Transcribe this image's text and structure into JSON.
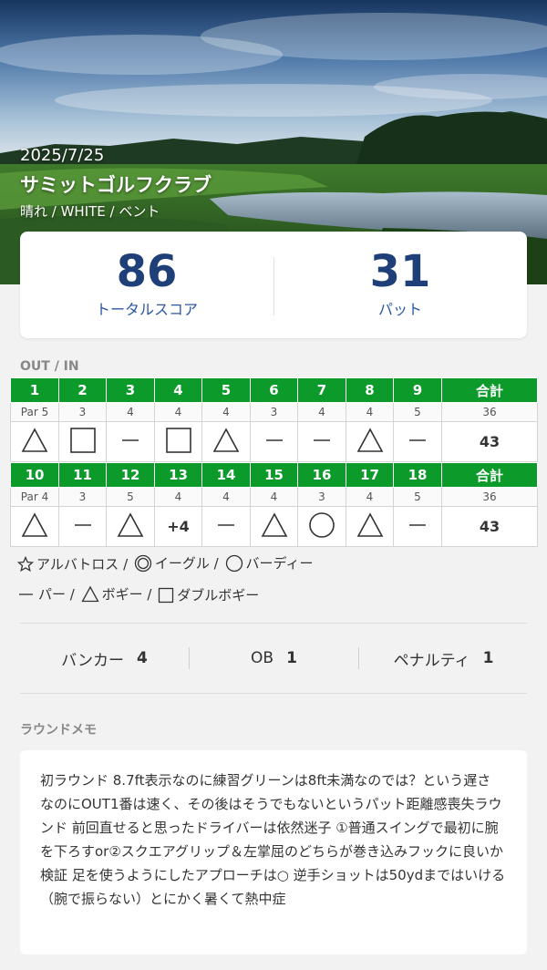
{
  "round": {
    "date": "2025/7/25",
    "club": "サミットゴルフクラブ",
    "conditions": "晴れ / WHITE  / ベント"
  },
  "summary": {
    "total_score": "86",
    "total_label": "トータルスコア",
    "putts": "31",
    "putts_label": "パット"
  },
  "scorecard": {
    "section_label": "OUT / IN",
    "total_header": "合計",
    "out": {
      "holes": [
        "1",
        "2",
        "3",
        "4",
        "5",
        "6",
        "7",
        "8",
        "9"
      ],
      "pars": [
        "Par 5",
        "3",
        "4",
        "4",
        "4",
        "3",
        "4",
        "4",
        "5"
      ],
      "par_total": "36",
      "results": [
        "bogey-triangle",
        "double-bogey-square",
        "par-dash",
        "double-bogey-square",
        "bogey-triangle",
        "par-dash",
        "par-dash",
        "bogey-triangle",
        "par-dash"
      ],
      "score_total": "43"
    },
    "in": {
      "holes": [
        "10",
        "11",
        "12",
        "13",
        "14",
        "15",
        "16",
        "17",
        "18"
      ],
      "pars": [
        "Par 4",
        "3",
        "5",
        "4",
        "4",
        "4",
        "3",
        "4",
        "5"
      ],
      "par_total": "36",
      "results": [
        "bogey-triangle",
        "par-dash",
        "bogey-triangle",
        "+4",
        "par-dash",
        "bogey-triangle",
        "birdie-circle",
        "bogey-triangle",
        "par-dash"
      ],
      "score_total": "43"
    }
  },
  "legend": {
    "albatross": "アルバトロス /",
    "eagle": "イーグル /",
    "birdie": "バーディー",
    "par": "パー /",
    "bogey": "ボギー /",
    "double_bogey": "ダブルボギー"
  },
  "stats": {
    "bunker_label": "バンカー",
    "bunker_value": "4",
    "ob_label": "OB",
    "ob_value": "1",
    "penalty_label": "ペナルティ",
    "penalty_value": "1"
  },
  "memo": {
    "label": "ラウンドメモ",
    "text": "初ラウンド 8.7ft表示なのに練習グリーンは8ft未満なのでは？という遅さ なのにOUT1番は速く、その後はそうでもないというパット距離感喪失ラウンド 前回直せると思ったドライバーは依然迷子 ①普通スイングで最初に腕を下ろすor②スクエアグリップ＆左掌屈のどちらが巻き込みフックに良いか検証 足を使うようにしたアプローチは○ 逆手ショットは50ydまではいける（腕で振らない）とにかく暑くて熱中症"
  },
  "colors": {
    "hole_header_bg": "#0c9a2b",
    "score_number": "#1e3f78",
    "score_label": "#2b57a1",
    "page_bg": "#f2f2f2"
  }
}
